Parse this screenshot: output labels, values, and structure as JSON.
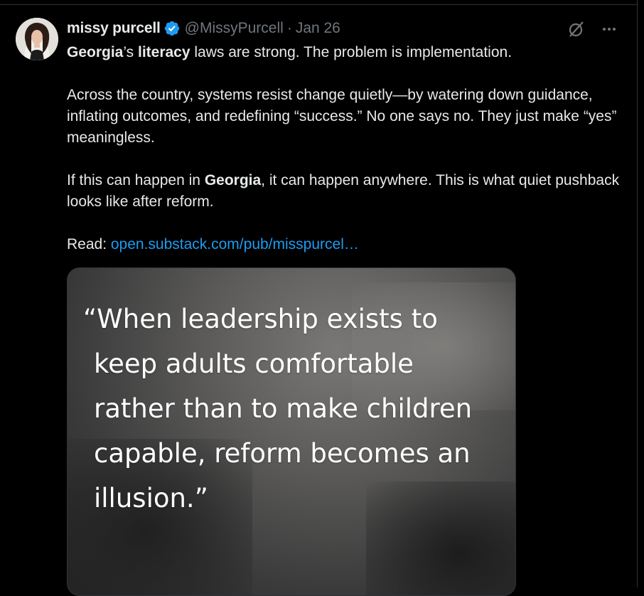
{
  "post": {
    "author": {
      "display_name": "missy purcell",
      "handle": "@MissyPurcell",
      "verified": true,
      "avatar_icon": "avatar-photo"
    },
    "separator": "·",
    "date": "Jan 26",
    "actions": {
      "grok_icon": "grok-slash-circle-icon",
      "more_icon": "more-dots-icon"
    },
    "text": {
      "p1": {
        "bold1": "Georgia",
        "t1": "’s ",
        "bold2": "literacy",
        "t2": " laws are strong. The problem is implementation."
      },
      "p2": "Across the country, systems resist change quietly—by watering down guidance, inflating outcomes, and redefining “success.” No one says no. They just make “yes” meaningless.",
      "p3": {
        "t1": "If this can happen in ",
        "bold1": "Georgia",
        "t2": ", it can happen anywhere. This is what quiet pushback looks like after reform."
      },
      "p4": {
        "label": "Read: ",
        "link": "open.substack.com/pub/misspurcel…"
      }
    },
    "media": {
      "quote_lines": [
        "“When leadership exists to",
        "keep adults comfortable",
        "rather than to make children",
        "capable, reform becomes an",
        "illusion.”"
      ]
    }
  },
  "colors": {
    "background": "#000000",
    "text": "#e7e9ea",
    "muted": "#71767b",
    "link": "#1d9bf0",
    "verified": "#1d9bf0"
  }
}
